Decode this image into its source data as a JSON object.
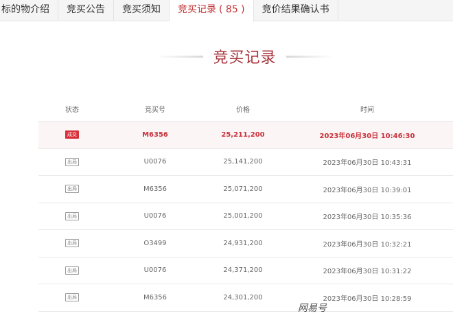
{
  "tabs": [
    {
      "label": "标的物介绍"
    },
    {
      "label": "竞买公告"
    },
    {
      "label": "竞买须知"
    },
    {
      "label": "竞买记录",
      "count": "( 85 )",
      "active": true
    },
    {
      "label": "竞价结果确认书"
    }
  ],
  "heading": {
    "title": "竞买记录"
  },
  "table": {
    "headers": {
      "status": "状态",
      "bid_no": "竞买号",
      "price": "价格",
      "time": "时间"
    },
    "rows": [
      {
        "status": "成交",
        "bid_no": "M6356",
        "price": "25,211,200",
        "time": "2023年06月30日 10:46:30"
      },
      {
        "status": "出局",
        "bid_no": "U0076",
        "price": "25,141,200",
        "time": "2023年06月30日 10:43:31"
      },
      {
        "status": "出局",
        "bid_no": "M6356",
        "price": "25,071,200",
        "time": "2023年06月30日 10:39:01"
      },
      {
        "status": "出局",
        "bid_no": "U0076",
        "price": "25,001,200",
        "time": "2023年06月30日 10:35:36"
      },
      {
        "status": "出局",
        "bid_no": "O3499",
        "price": "24,931,200",
        "time": "2023年06月30日 10:32:21"
      },
      {
        "status": "出局",
        "bid_no": "U0076",
        "price": "24,371,200",
        "time": "2023年06月30日 10:31:22"
      },
      {
        "status": "出局",
        "bid_no": "M6356",
        "price": "24,301,200",
        "time": "2023年06月30日 10:28:59"
      }
    ]
  },
  "watermark": "网易号",
  "colors": {
    "accent": "#c03234",
    "deal_badge": "#d8303a",
    "tab_bar": "#f5f5f5"
  }
}
